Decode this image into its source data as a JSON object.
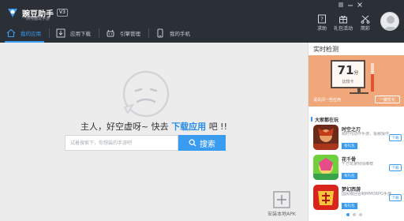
{
  "app": {
    "name": "豌豆助手",
    "version": "V3",
    "subtitle": "一网电脑玩手游"
  },
  "top_tools": [
    {
      "label": "求助",
      "icon": "help-icon"
    },
    {
      "label": "礼包活动",
      "icon": "gift-icon"
    },
    {
      "label": "简彩",
      "icon": "scissors-icon"
    }
  ],
  "tabs": [
    {
      "label": "我的应用",
      "icon": "home-icon",
      "active": true
    },
    {
      "label": "应用下载",
      "icon": "download-icon",
      "active": false
    },
    {
      "label": "引擎管理",
      "icon": "engine-icon",
      "active": false
    },
    {
      "label": "我的手机",
      "icon": "phone-icon",
      "active": false
    }
  ],
  "main": {
    "headline_prefix": "主人，好空虚呀~ 快去",
    "headline_link": "下载应用",
    "headline_suffix": "吧 !!",
    "search_placeholder": "试着搜索下，你想装的手游吧",
    "search_button": "搜索",
    "install_apk_label": "安装本地APK"
  },
  "side": {
    "title": "实时检测",
    "score": "71",
    "score_unit": "分",
    "score_label": "比较卡",
    "tip": "请关闭一些应用",
    "optimize_button": "一键优化",
    "games_title": "大家都在玩",
    "games": [
      {
        "name": "时空之刃",
        "desc": "跨时代动作手游，极致操作",
        "button": "有礼包",
        "download": "下载",
        "icon": "game-icon-warrior"
      },
      {
        "name": "花千骨",
        "desc": "千万玩家倾情推荐",
        "button": "有礼包",
        "download": "下载",
        "icon": "game-icon-fairy"
      },
      {
        "name": "梦幻西游",
        "desc": "国民级回合制MMORPG手游",
        "button": "有礼包",
        "download": "下载",
        "icon": "game-icon-monkey"
      }
    ],
    "pager_count": 3,
    "pager_active": 0
  },
  "colors": {
    "topbar": "#2b2f36",
    "accent": "#3a9cf0",
    "monitor": "#f0a77a",
    "background": "#ececec"
  }
}
